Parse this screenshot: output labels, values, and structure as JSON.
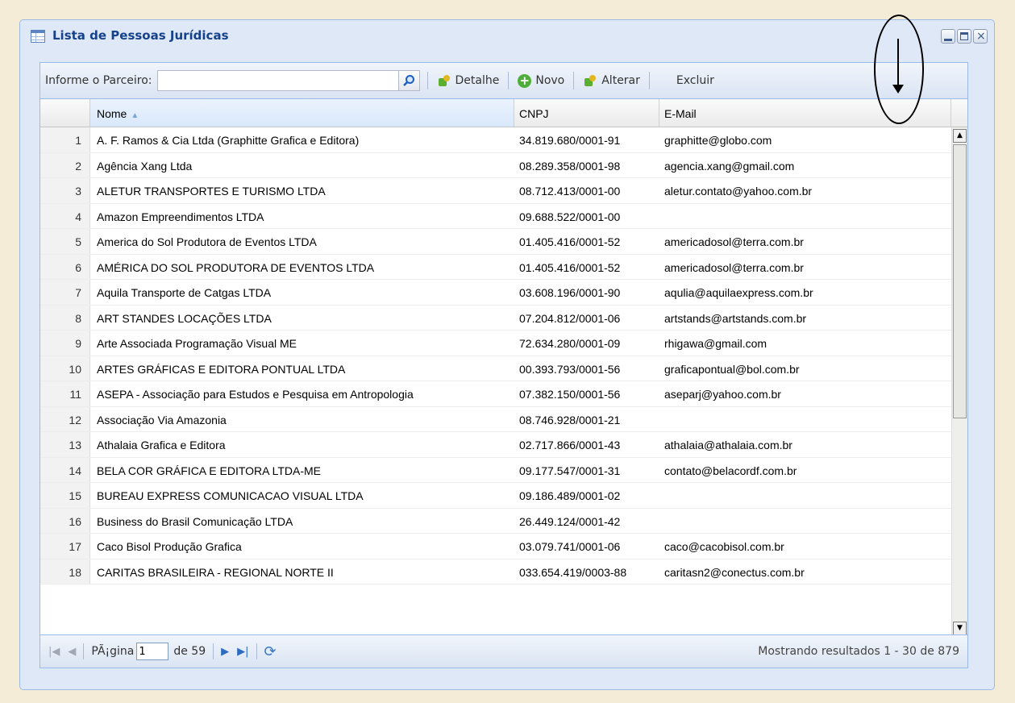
{
  "window": {
    "title": "Lista de Pessoas Jurídicas"
  },
  "toolbar": {
    "search_label": "Informe o Parceiro:",
    "search_value": "",
    "detalhe": "Detalhe",
    "novo": "Novo",
    "alterar": "Alterar",
    "excluir": "Excluir"
  },
  "columns": {
    "nome": "Nome",
    "cnpj": "CNPJ",
    "email": "E-Mail"
  },
  "rows": [
    {
      "n": "1",
      "nome": "A. F. Ramos & Cia Ltda (Graphitte Grafica e Editora)",
      "cnpj": "34.819.680/0001-91",
      "email": "graphitte@globo.com"
    },
    {
      "n": "2",
      "nome": "Agência Xang Ltda",
      "cnpj": "08.289.358/0001-98",
      "email": "agencia.xang@gmail.com"
    },
    {
      "n": "3",
      "nome": "ALETUR TRANSPORTES E TURISMO LTDA",
      "cnpj": "08.712.413/0001-00",
      "email": "aletur.contato@yahoo.com.br"
    },
    {
      "n": "4",
      "nome": "Amazon Empreendimentos LTDA",
      "cnpj": "09.688.522/0001-00",
      "email": ""
    },
    {
      "n": "5",
      "nome": "America do Sol Produtora de Eventos LTDA",
      "cnpj": "01.405.416/0001-52",
      "email": "americadosol@terra.com.br"
    },
    {
      "n": "6",
      "nome": "AMÉRICA DO SOL PRODUTORA DE EVENTOS LTDA",
      "cnpj": "01.405.416/0001-52",
      "email": "americadosol@terra.com.br"
    },
    {
      "n": "7",
      "nome": "Aquila Transporte de Catgas LTDA",
      "cnpj": "03.608.196/0001-90",
      "email": "aqulia@aquilaexpress.com.br"
    },
    {
      "n": "8",
      "nome": "ART STANDES LOCAÇÕES LTDA",
      "cnpj": "07.204.812/0001-06",
      "email": "artstands@artstands.com.br"
    },
    {
      "n": "9",
      "nome": "Arte Associada Programação Visual ME",
      "cnpj": "72.634.280/0001-09",
      "email": "rhigawa@gmail.com"
    },
    {
      "n": "10",
      "nome": "ARTES GRÁFICAS E EDITORA PONTUAL LTDA",
      "cnpj": "00.393.793/0001-56",
      "email": "graficapontual@bol.com.br"
    },
    {
      "n": "11",
      "nome": "ASEPA - Associação para Estudos e Pesquisa em Antropologia",
      "cnpj": "07.382.150/0001-56",
      "email": "aseparj@yahoo.com.br"
    },
    {
      "n": "12",
      "nome": "Associação Via Amazonia",
      "cnpj": "08.746.928/0001-21",
      "email": ""
    },
    {
      "n": "13",
      "nome": "Athalaia Grafica e Editora",
      "cnpj": "02.717.866/0001-43",
      "email": "athalaia@athalaia.com.br"
    },
    {
      "n": "14",
      "nome": "BELA COR GRÁFICA E EDITORA LTDA-ME",
      "cnpj": "09.177.547/0001-31",
      "email": "contato@belacordf.com.br"
    },
    {
      "n": "15",
      "nome": "BUREAU EXPRESS COMUNICACAO VISUAL LTDA",
      "cnpj": "09.186.489/0001-02",
      "email": ""
    },
    {
      "n": "16",
      "nome": "Business do Brasil Comunicação LTDA",
      "cnpj": "26.449.124/0001-42",
      "email": ""
    },
    {
      "n": "17",
      "nome": "Caco Bisol Produção Grafica",
      "cnpj": "03.079.741/0001-06",
      "email": "caco@cacobisol.com.br"
    },
    {
      "n": "18",
      "nome": "CARITAS BRASILEIRA - REGIONAL NORTE II",
      "cnpj": "033.654.419/0003-88",
      "email": "caritasn2@conectus.com.br"
    }
  ],
  "pager": {
    "page_label": "PÃ¡gina",
    "page_value": "1",
    "of_label": "de 59",
    "status": "Mostrando resultados 1 - 30 de 879"
  },
  "colors": {
    "title": "#15428b",
    "border": "#99bbe8",
    "background": "#f4ecd6"
  }
}
